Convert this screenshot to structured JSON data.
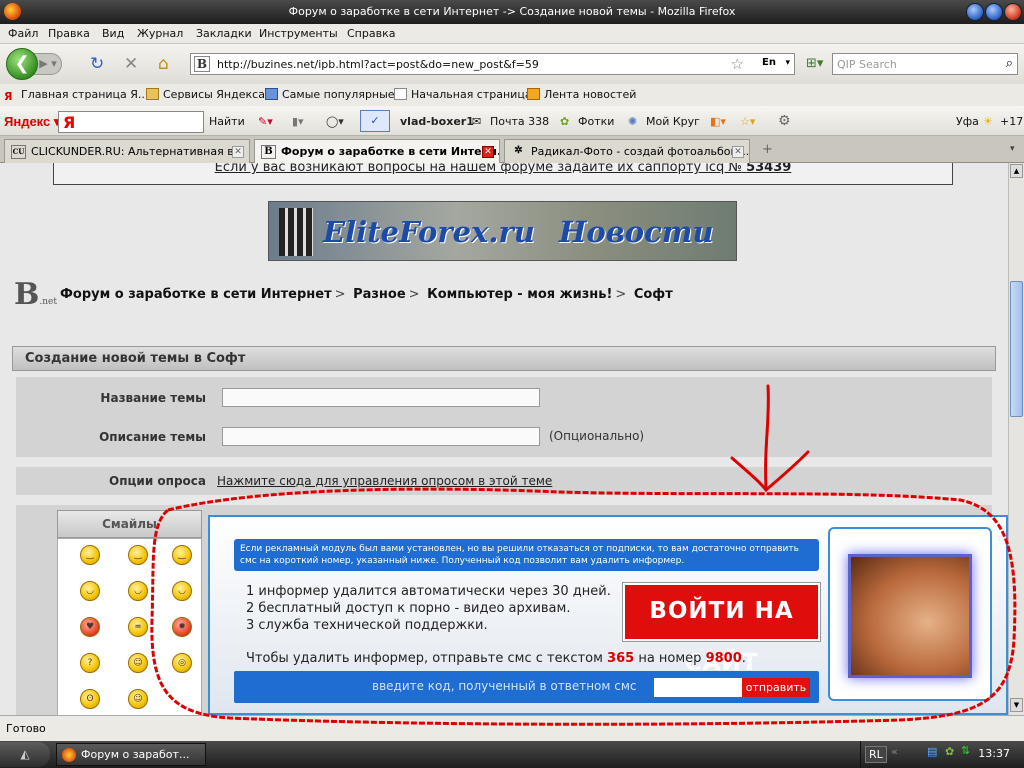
{
  "window": {
    "title": "Форум о заработке в сети Интернет -> Создание новой темы - Mozilla Firefox"
  },
  "menu": [
    "Файл",
    "Правка",
    "Вид",
    "Журнал",
    "Закладки",
    "Инструменты",
    "Справка"
  ],
  "nav": {
    "url": "http://buzines.net/ipb.html?act=post&do=new_post&f=59",
    "lang": "En",
    "search_placeholder": "QIP Search"
  },
  "bookmarks": [
    "Главная страница Я...",
    "Сервисы Яндекса",
    "Самые популярные",
    "Начальная страница",
    "Лента новостей"
  ],
  "yandex_bar": {
    "logo": "Яндекс",
    "find": "Найти",
    "user": "vlad-boxer1",
    "mail": "Почта 338",
    "photo": "Фотки",
    "circle": "Мой Круг",
    "city": "Уфа",
    "temp": "+17"
  },
  "tabs": [
    {
      "label": "CLICKUNDER.RU: Альтернативная в...",
      "favicon": "CU"
    },
    {
      "label": "Форум о заработке в сети Интерн...",
      "favicon": "B"
    },
    {
      "label": "Радикал-Фото - создай фотоальбом ...",
      "favicon": "✲"
    }
  ],
  "page": {
    "notice": "Если у вас возникают вопросы на нашем форуме задайте их саппорту icq №",
    "notice_icq": "53439",
    "banner": {
      "site": "EliteForex.ru",
      "section": "Новости"
    },
    "site_logo": {
      "letter": "B",
      "sub": ".net"
    },
    "breadcrumb": [
      "Форум о заработке в сети Интернет",
      "Разное",
      "Компьютер - моя жизнь!",
      "Софт"
    ],
    "breadcrumb_sep": ">",
    "section_title": "Создание новой темы в Софт",
    "topic_label": "Название темы",
    "desc_label": "Описание темы",
    "optional": "(Опционально)",
    "poll_label": "Опции опроса",
    "poll_link": "Нажмите сюда для управления опросом в этой теме",
    "smilies_header": "Смайлы"
  },
  "popup": {
    "info": "Если рекламный модуль был вами установлен, но вы решили отказаться от подписки, то вам достаточно отправить смс на короткий номер, указанный ниже. Полученный код позволит вам удалить информер.",
    "list": [
      "1 информер удалится автоматически через 30 дней.",
      "2 бесплатный доступ к порно - видео архивам.",
      "3 служба технической поддержки."
    ],
    "button": "ВОЙТИ НА САЙТ",
    "sms_prefix": "Чтобы удалить информер, отправьте смс с текстом",
    "sms_code": "365",
    "sms_mid": "на номер",
    "sms_number": "9800",
    "code_label": "введите код, полученный в ответном смс",
    "send": "отправить"
  },
  "status": {
    "text": "Готово"
  },
  "taskbar": {
    "item": "Форум о заработ...",
    "lang": "RL",
    "clock": "13:37"
  },
  "colors": {
    "accent_blue": "#1f6dd3",
    "popup_red": "#e00d0d",
    "scribble": "#dd0000"
  }
}
